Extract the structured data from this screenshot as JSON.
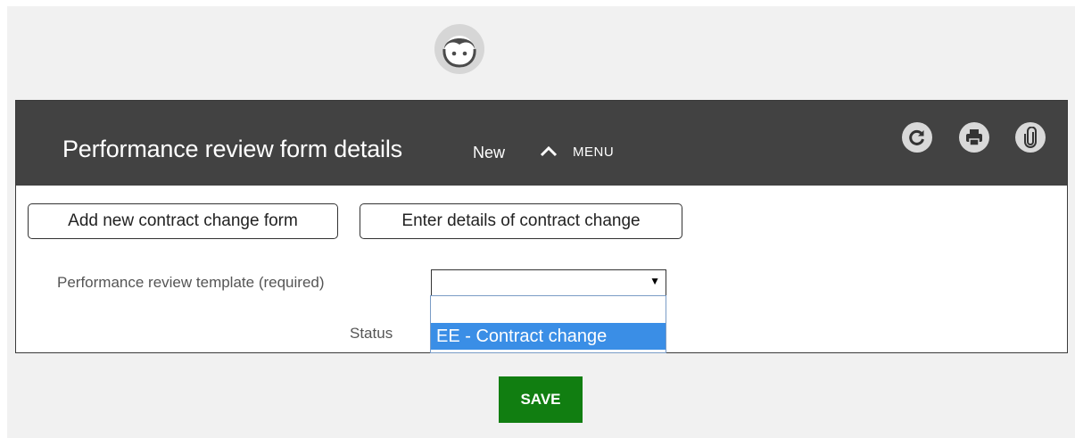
{
  "header": {
    "title": "Performance review form details",
    "subtitle": "New",
    "menu_label": "MENU"
  },
  "icons": {
    "avatar": "face-avatar-icon",
    "collapse": "chevron-up-icon",
    "refresh": "refresh-icon",
    "print": "print-icon",
    "attach": "paperclip-icon"
  },
  "actions": {
    "add_new": "Add new contract change form",
    "enter_details": "Enter details of contract change"
  },
  "form": {
    "template_label": "Performance review template (required)",
    "template_value": "",
    "status_label": "Status",
    "dropdown_options": [
      "",
      "EE - Contract change"
    ],
    "highlighted_option": "EE - Contract change"
  },
  "footer": {
    "save_label": "SAVE"
  },
  "colors": {
    "header_bg": "#424242",
    "save_bg": "#117e11",
    "highlight": "#3a8ee6"
  }
}
